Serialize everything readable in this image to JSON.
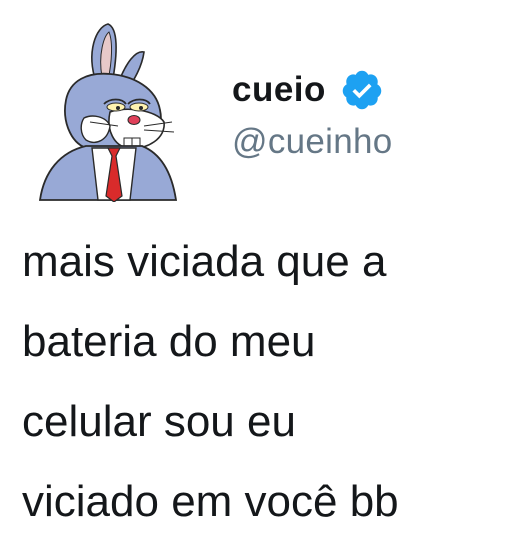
{
  "user": {
    "display_name": "cueio",
    "handle": "@cueinho",
    "verified": true,
    "avatar_icon": "bugs-bunny-avatar-icon",
    "verified_icon": "verified-badge-icon"
  },
  "tweet": {
    "lines": [
      "mais viciada que a",
      "bateria do meu",
      "celular sou eu",
      "viciado em você bb"
    ]
  },
  "colors": {
    "text": "#14171a",
    "handle": "#657786",
    "verified": "#1da1f2"
  }
}
